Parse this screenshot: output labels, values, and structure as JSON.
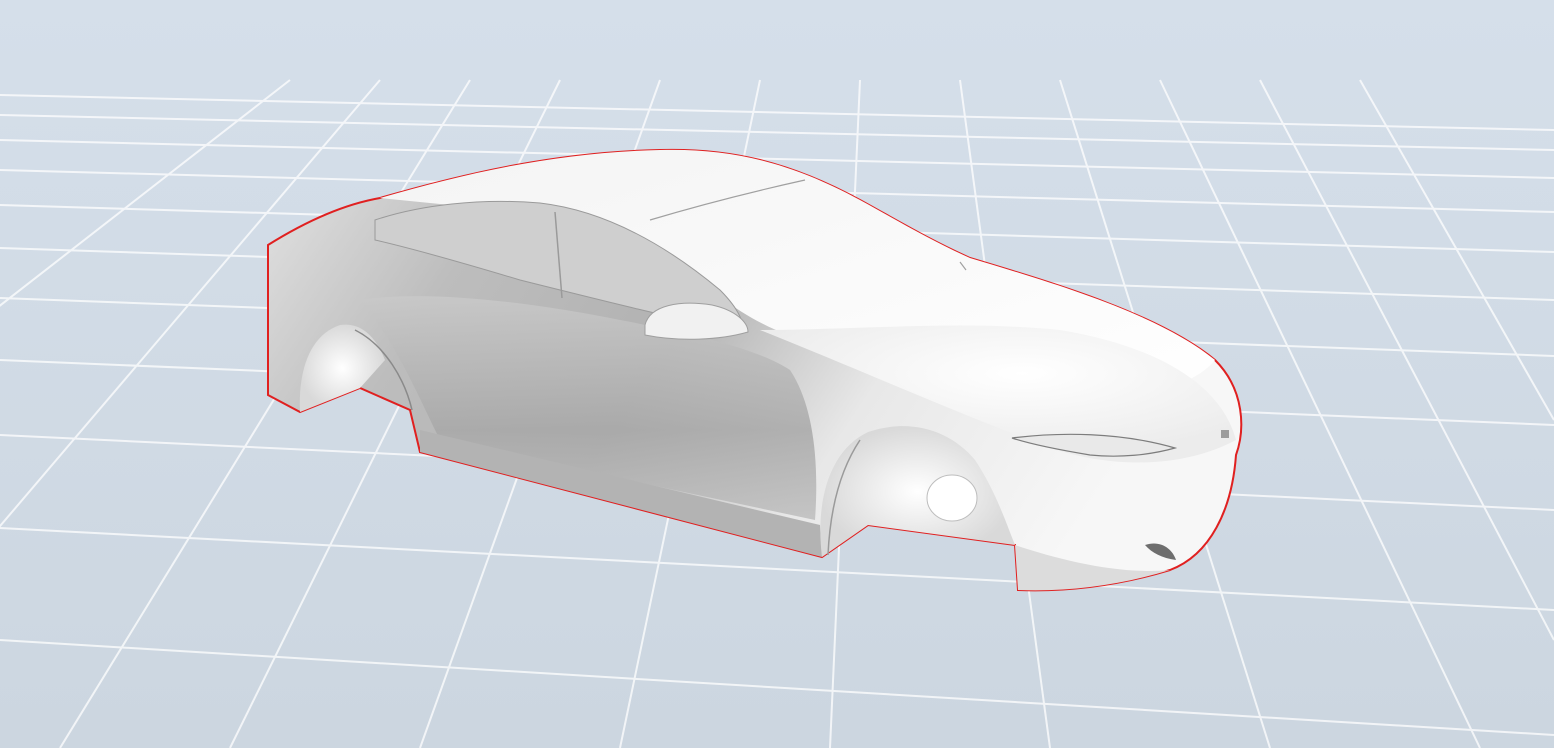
{
  "viewer": {
    "background_top": "#d5dfea",
    "background_bottom": "#ccd6e0",
    "grid_color": "#ffffff",
    "model_color": "#f2f2f2",
    "model_shadow_color": "#a9a9a9",
    "selection_outline_color": "#e02020",
    "model_selected": true
  }
}
